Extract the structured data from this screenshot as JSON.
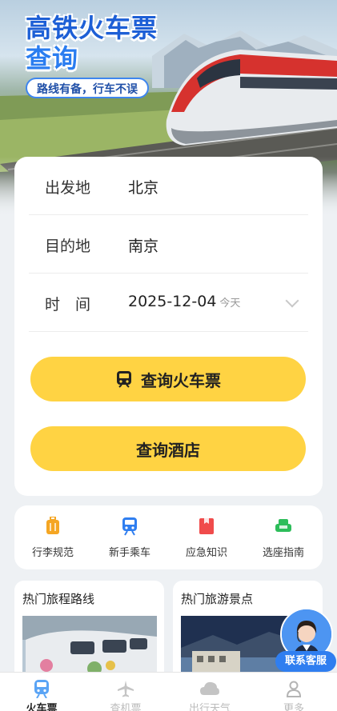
{
  "hero": {
    "title_line1": "高铁火车票",
    "title_line2": "查询",
    "subtitle": "路线有备，行车不误"
  },
  "form": {
    "departure": {
      "label": "出发地",
      "value": "北京"
    },
    "destination": {
      "label": "目的地",
      "value": "南京"
    },
    "date": {
      "label": "时　间",
      "value": "2025-12-04",
      "note": "今天"
    },
    "search_train_button": "查询火车票",
    "search_hotel_button": "查询酒店"
  },
  "quick_links": [
    {
      "label": "行李规范",
      "icon": "luggage-icon",
      "color": "#f5a623"
    },
    {
      "label": "新手乘车",
      "icon": "train-icon",
      "color": "#2f7ef0"
    },
    {
      "label": "应急知识",
      "icon": "first-aid-icon",
      "color": "#f04b4b"
    },
    {
      "label": "选座指南",
      "icon": "seat-icon",
      "color": "#2dbd5a"
    }
  ],
  "hot_sections": {
    "routes": {
      "title": "热门旅程路线"
    },
    "attractions": {
      "title": "热门旅游景点"
    }
  },
  "customer_service": {
    "label": "联系客服"
  },
  "tabs": [
    {
      "label": "火车票",
      "icon": "train-icon",
      "active": true
    },
    {
      "label": "查机票",
      "icon": "plane-icon",
      "active": false
    },
    {
      "label": "出行天气",
      "icon": "cloud-icon",
      "active": false
    },
    {
      "label": "更多",
      "icon": "person-icon",
      "active": false
    }
  ],
  "colors": {
    "accent": "#ffd343",
    "brand_blue": "#2f7ef0",
    "background": "#eef1f4"
  }
}
